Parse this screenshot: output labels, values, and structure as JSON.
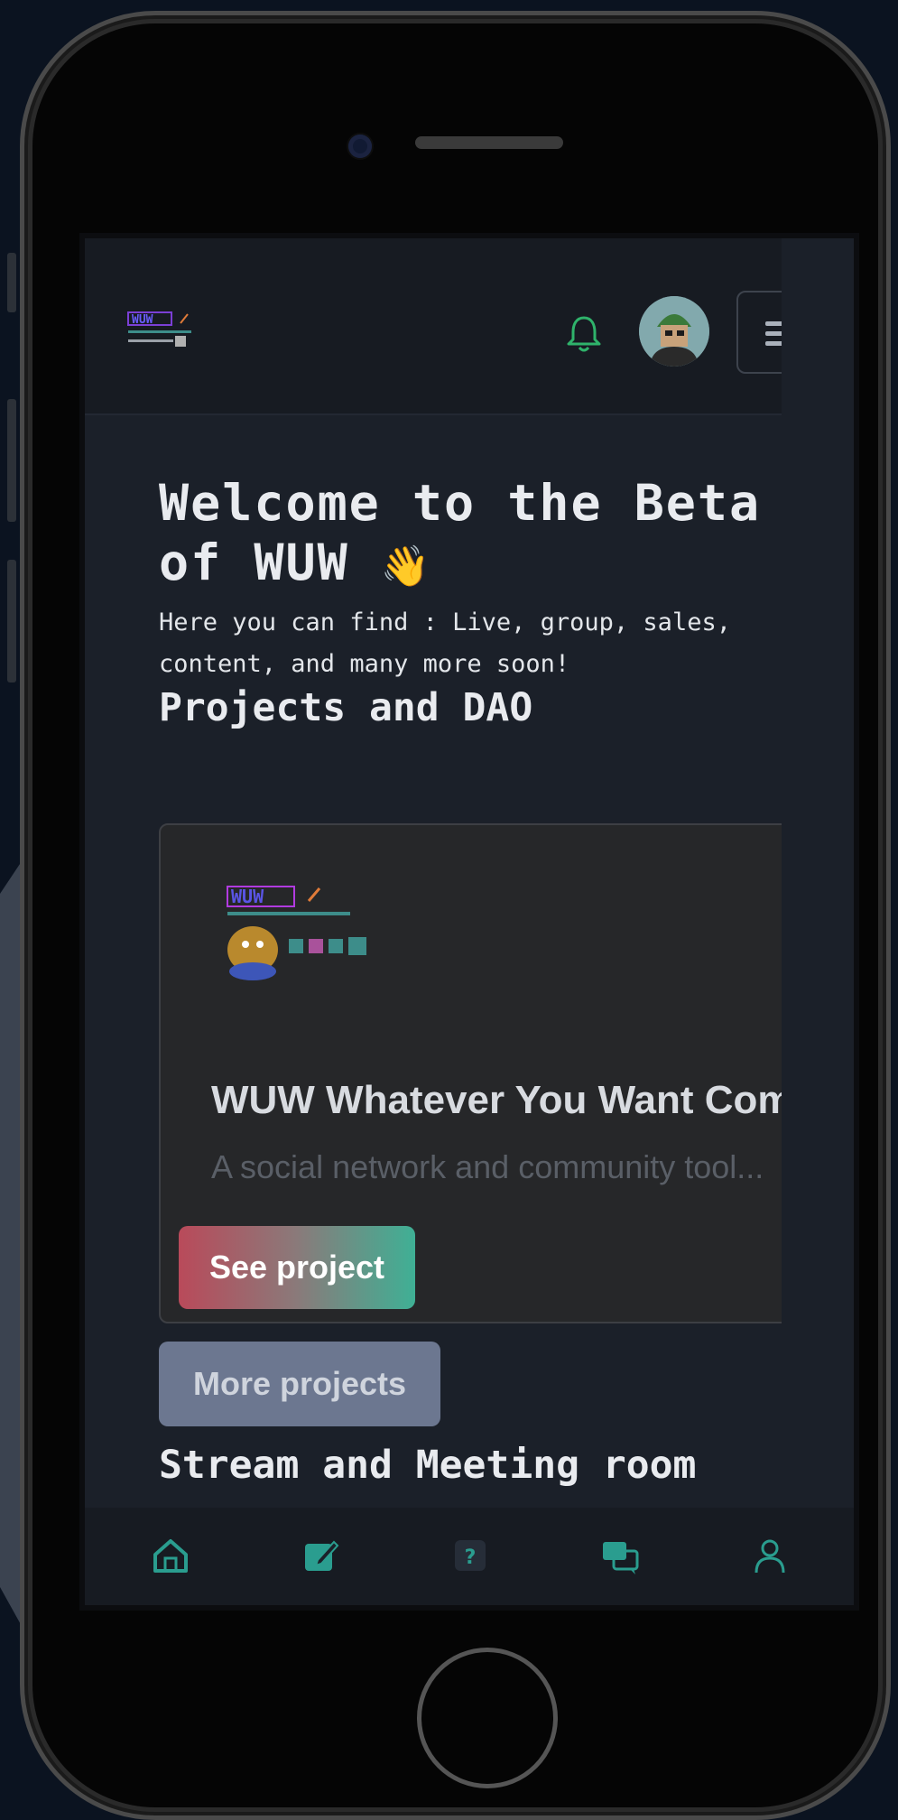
{
  "header": {
    "logo_alt": "WUW",
    "notifications_icon": "bell-icon",
    "menu_icon": "hamburger-icon"
  },
  "hero": {
    "title": "Welcome to the Beta of WUW",
    "emoji": "👋",
    "subtitle": "Here you can find : Live, group, sales, content, and many more soon!"
  },
  "projects": {
    "section_title": "Projects and DAO",
    "card": {
      "title": "WUW Whatever You Want Community",
      "description": "A social network and community tool...",
      "button_label": "See project"
    },
    "more_label": "More projects"
  },
  "stream": {
    "section_title": "Stream and Meeting room"
  },
  "bottom_nav": {
    "items": [
      "home-icon",
      "edit-icon",
      "help-icon",
      "chat-icon",
      "profile-icon"
    ]
  },
  "colors": {
    "accent_green": "#3fb095",
    "accent_red": "#b94a5a",
    "bell_green": "#2fb36b",
    "muted_button": "#6c7790",
    "background": "#1b2029"
  }
}
